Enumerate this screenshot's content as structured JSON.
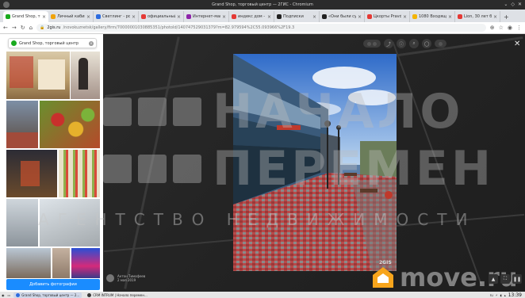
{
  "window": {
    "title": "Grand Shop, торговый центр — 2ГИС - Chromium"
  },
  "tabs": [
    {
      "label": "Grand Shop, тор",
      "color": "#19aa1e",
      "active": true
    },
    {
      "label": "Личный кабин",
      "color": "#f0a30a",
      "active": false
    },
    {
      "label": "Светлинг - рос",
      "color": "#2d6cdf",
      "active": false
    },
    {
      "label": "официальный",
      "color": "#e53935",
      "active": false
    },
    {
      "label": "Интернет-маг",
      "color": "#8e24aa",
      "active": false
    },
    {
      "label": "индекс дом -",
      "color": "#e53935",
      "active": false
    },
    {
      "label": "Подписки",
      "color": "#212121",
      "active": false
    },
    {
      "label": "«Они были су»",
      "color": "#212121",
      "active": false
    },
    {
      "label": "Цкорты Pravda",
      "color": "#e53935",
      "active": false
    },
    {
      "label": "1080 Входящие",
      "color": "#f4b400",
      "active": false
    },
    {
      "label": "Lion, 30 лет был",
      "color": "#e53935",
      "active": false
    }
  ],
  "newtab_label": "+",
  "addressbar": {
    "host": "2gis.ru",
    "path": "/novokuznetsk/gallery/firm/70000001030885351/photoId/140747529031379?m=82.979594%2C55.093966%2F19.3"
  },
  "search": {
    "value": "Grand Shop, торговый центр"
  },
  "panel": {
    "add_photo_label": "Добавить фотографии"
  },
  "viewer": {
    "author_name": "Антон Тимофеев",
    "author_date": "2 мая 2019",
    "map_logo": "2GIS",
    "close_label": "✕"
  },
  "watermark": {
    "line1": "НАЧАЛО",
    "line2": "ПЕРЕМЕН",
    "line3": "АГЕНТСТВО НЕДВИЖИМОСТИ",
    "move_text": "move.ru",
    "move_color": "#f7a51c"
  },
  "taskbar": {
    "items": [
      {
        "label": "Grand Shop, торговый центр — 2...",
        "color": "#2d6cdf",
        "active": true
      },
      {
        "label": "CRM INTRUM | Начало перемен...",
        "color": "#3a3a3a",
        "active": false
      }
    ],
    "tray_lang": "ru",
    "clock": "13:39"
  }
}
